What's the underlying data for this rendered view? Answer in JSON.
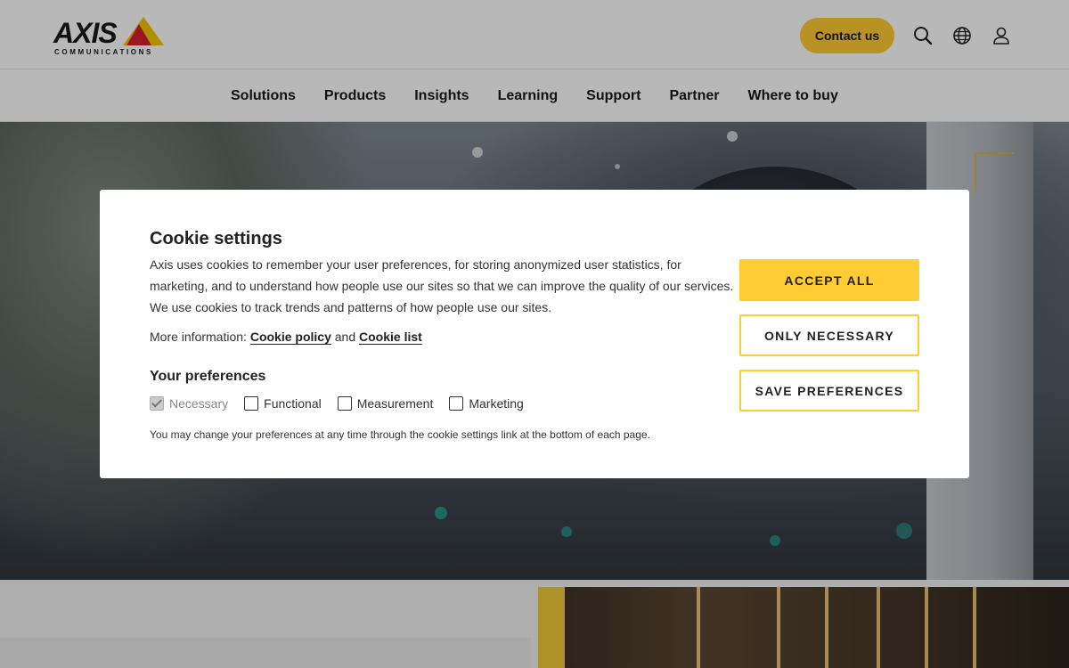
{
  "header": {
    "logo_word": "AXIS",
    "logo_sub": "COMMUNICATIONS",
    "contact_label": "Contact us",
    "icons": [
      "search-icon",
      "globe-icon",
      "user-icon"
    ],
    "brand_color": "#ffcc33"
  },
  "nav": {
    "items": [
      {
        "label": "Solutions"
      },
      {
        "label": "Products"
      },
      {
        "label": "Insights"
      },
      {
        "label": "Learning"
      },
      {
        "label": "Support"
      },
      {
        "label": "Partner"
      },
      {
        "label": "Where to buy"
      }
    ]
  },
  "cookie_modal": {
    "title": "Cookie settings",
    "description": "Axis uses cookies to remember your user preferences, for storing anonymized user statistics, for marketing, and to understand how people use our sites so that we can improve the quality of our services. We use cookies to track trends and patterns of how people use our sites.",
    "more_info_prefix": "More information:",
    "cookie_policy_link": "Cookie policy",
    "and_text": "and",
    "cookie_list_link": "Cookie list",
    "preferences_title": "Your preferences",
    "preferences": [
      {
        "label": "Necessary",
        "checked": true,
        "disabled": true
      },
      {
        "label": "Functional",
        "checked": false,
        "disabled": false
      },
      {
        "label": "Measurement",
        "checked": false,
        "disabled": false
      },
      {
        "label": "Marketing",
        "checked": false,
        "disabled": false
      }
    ],
    "note": "You may change your preferences at any time through the cookie settings link at the bottom of each page.",
    "accept_all_label": "ACCEPT ALL",
    "only_necessary_label": "ONLY NECESSARY",
    "save_preferences_label": "SAVE PREFERENCES"
  }
}
